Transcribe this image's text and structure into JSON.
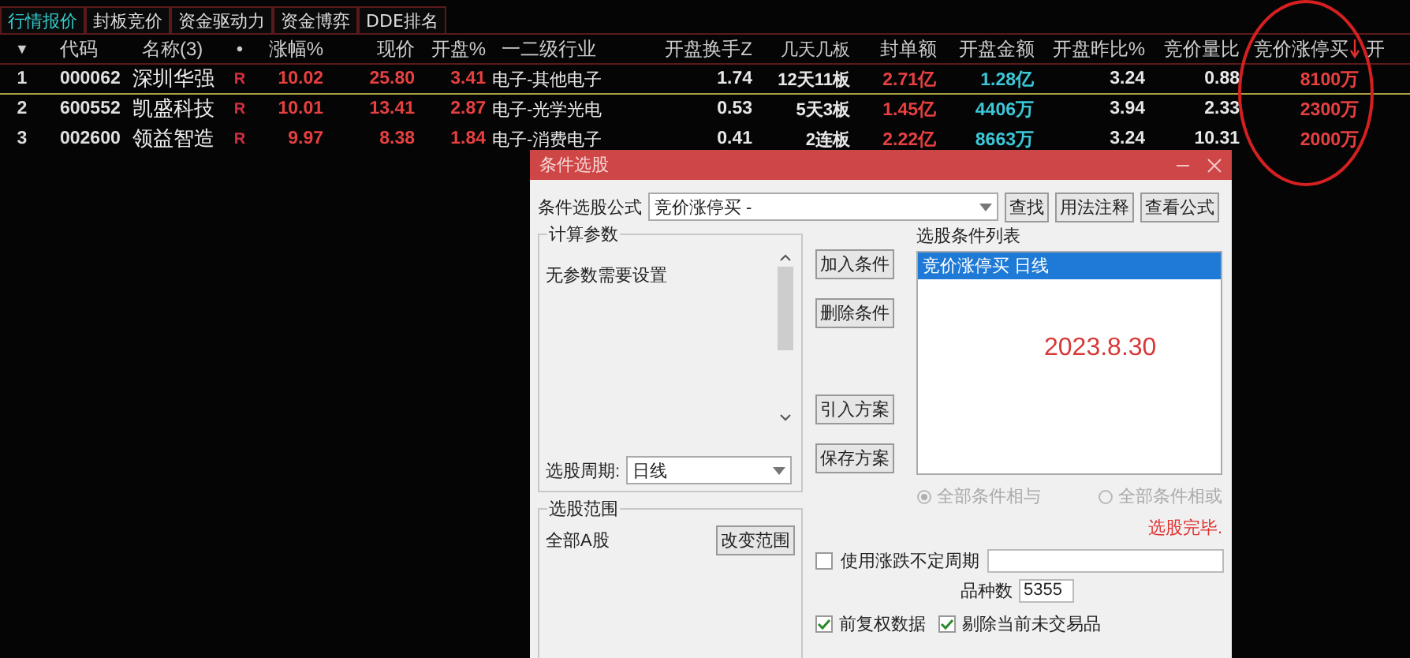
{
  "tabs": [
    {
      "label": "行情报价",
      "selected": true
    },
    {
      "label": "封板竞价",
      "selected": false
    },
    {
      "label": "资金驱动力",
      "selected": false
    },
    {
      "label": "资金博弈",
      "selected": false
    },
    {
      "label": "DDE排名",
      "selected": false
    }
  ],
  "table": {
    "columns": [
      {
        "label": "▼",
        "sorted": false
      },
      {
        "label": "代码",
        "sorted": false
      },
      {
        "label": "名称(3)",
        "sorted": false
      },
      {
        "label": "•",
        "sorted": false
      },
      {
        "label": "涨幅%",
        "sorted": false
      },
      {
        "label": "现价",
        "sorted": false
      },
      {
        "label": "开盘%",
        "sorted": false
      },
      {
        "label": "一二级行业",
        "sorted": false
      },
      {
        "label": "开盘换手Z",
        "sorted": false
      },
      {
        "label": "几天几板",
        "sorted": false
      },
      {
        "label": "封单额",
        "sorted": false
      },
      {
        "label": "开盘金额",
        "sorted": false
      },
      {
        "label": "开盘昨比%",
        "sorted": false
      },
      {
        "label": "竞价量比",
        "sorted": false
      },
      {
        "label": "竞价涨停买",
        "sorted": true
      },
      {
        "label": "开",
        "sorted": false
      }
    ],
    "rows": [
      {
        "selected": true,
        "cells": [
          "1",
          "000062",
          "深圳华强",
          "R",
          "10.02",
          "25.80",
          "3.41",
          "电子-其他电子",
          "1.74",
          "12天11板",
          "2.71亿",
          "1.28亿",
          "3.24",
          "0.88",
          "8100万"
        ]
      },
      {
        "selected": false,
        "cells": [
          "2",
          "600552",
          "凯盛科技",
          "R",
          "10.01",
          "13.41",
          "2.87",
          "电子-光学光电",
          "0.53",
          "5天3板",
          "1.45亿",
          "4406万",
          "3.94",
          "2.33",
          "2300万"
        ]
      },
      {
        "selected": false,
        "cells": [
          "3",
          "002600",
          "领益智造",
          "R",
          "9.97",
          "8.38",
          "1.84",
          "电子-消费电子",
          "0.41",
          "2连板",
          "2.22亿",
          "8663万",
          "3.24",
          "10.31",
          "2000万"
        ]
      }
    ]
  },
  "dialog": {
    "title": "条件选股",
    "formula_label": "条件选股公式",
    "formula_value": "竞价涨停买  -",
    "top_buttons": [
      "查找",
      "用法注释",
      "查看公式"
    ],
    "params": {
      "title": "计算参数",
      "message": "无参数需要设置",
      "period_label": "选股周期:",
      "period_value": "日线"
    },
    "middle_buttons": [
      "加入条件",
      "删除条件",
      "引入方案",
      "保存方案"
    ],
    "list_label": "选股条件列表",
    "conditions": [
      {
        "label": "竞价涨停买  日线",
        "selected": true
      }
    ],
    "annotation": "2023.8.30",
    "logic": [
      {
        "label": "全部条件相与",
        "selected": true
      },
      {
        "label": "全部条件相或",
        "selected": false
      }
    ],
    "status": "选股完毕.",
    "scope": {
      "title": "选股范围",
      "value": "全部A股",
      "button": "改变范围"
    },
    "period_option": {
      "label": "使用涨跌不定周期",
      "checked": false
    },
    "count_label": "品种数",
    "count_value": "5355",
    "bottom_checks": [
      {
        "label": "前复权数据",
        "checked": true
      },
      {
        "label": "剔除当前未交易品",
        "checked": true
      }
    ]
  }
}
